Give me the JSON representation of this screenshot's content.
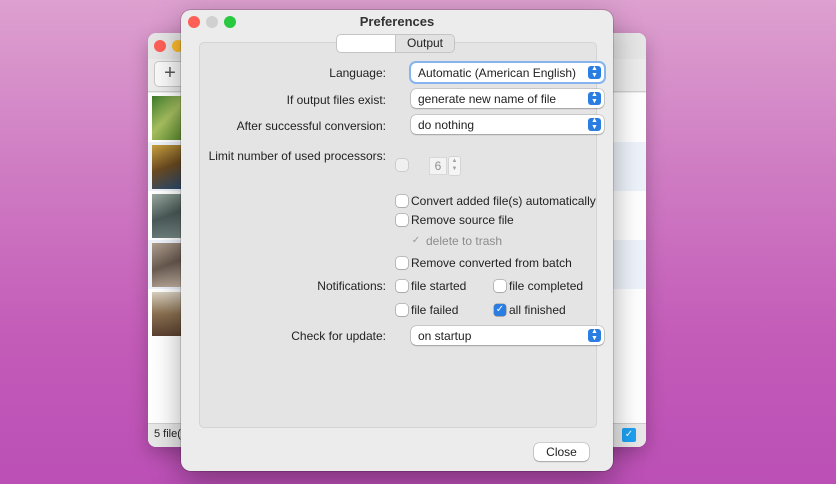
{
  "background_window": {
    "add_button": "+",
    "status_text": "5 file(",
    "twitter_icon": "twitter-icon"
  },
  "preferences": {
    "title": "Preferences",
    "tabs": [
      {
        "label": "",
        "selected": true
      },
      {
        "label": "Output",
        "selected": false
      }
    ],
    "language": {
      "label": "Language:",
      "value": "Automatic (American English)"
    },
    "output_exists": {
      "label": "If output files exist:",
      "value": "generate new name of file"
    },
    "after_conversion": {
      "label": "After successful conversion:",
      "value": "do nothing"
    },
    "processors": {
      "label": "Limit number of used processors:",
      "checked": false,
      "value": "6"
    },
    "options": {
      "convert_auto": {
        "label": "Convert added file(s) automatically",
        "checked": false
      },
      "remove_source": {
        "label": "Remove source file",
        "checked": false
      },
      "delete_trash": {
        "label": "delete to trash",
        "checked": true,
        "enabled": false
      },
      "remove_converted": {
        "label": "Remove converted from batch",
        "checked": false
      }
    },
    "notifications": {
      "label": "Notifications:",
      "file_started": {
        "label": "file started",
        "checked": false
      },
      "file_completed": {
        "label": "file completed",
        "checked": false
      },
      "file_failed": {
        "label": "file failed",
        "checked": false
      },
      "all_finished": {
        "label": "all finished",
        "checked": true
      }
    },
    "update": {
      "label": "Check for update:",
      "value": "on startup"
    },
    "close_label": "Close"
  },
  "colors": {
    "accent": "#2a7de1",
    "close_dot": "#fe5f57",
    "minimize_dot": "#febc2e",
    "zoom_dot": "#28c840"
  }
}
